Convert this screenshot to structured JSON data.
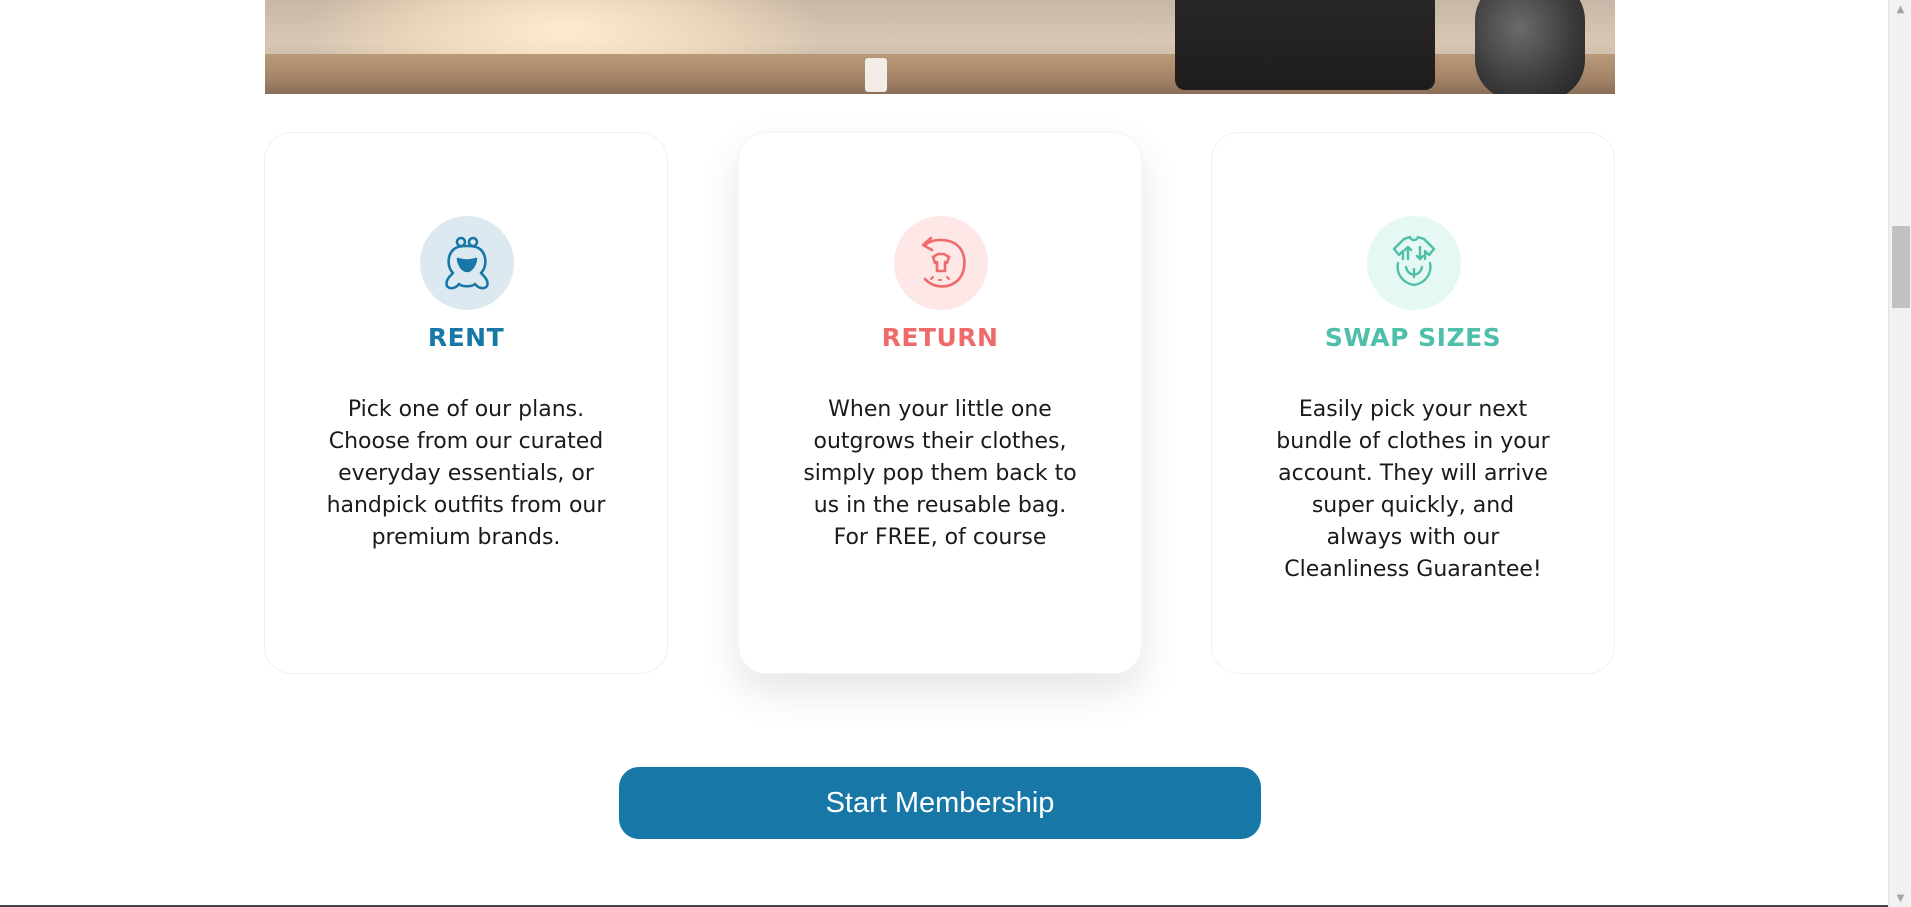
{
  "hero": {
    "alt": "hero-photo"
  },
  "cards": [
    {
      "title": "RENT",
      "text": "Pick one of our plans. Choose from our curated everyday essentials, or handpick outfits from our premium brands.",
      "icon": "frog-baby-icon",
      "title_color": "#1778a8",
      "icon_bg": "#dde9f1",
      "icon_color": "#1778a8"
    },
    {
      "title": "RETURN",
      "text": "When your little one outgrows their clothes, simply pop them back to us in the reusable bag. For FREE, of course",
      "icon": "return-shirt-icon",
      "title_color": "#ef6a6a",
      "icon_bg": "#fde7e7",
      "icon_color": "#ef6a6a"
    },
    {
      "title": "SWAP SIZES",
      "text": "Easily pick your next bundle of clothes in your account. They will arrive super quickly, and always with our Cleanliness Guarantee!",
      "icon": "swap-onesie-icon",
      "title_color": "#4fbfaa",
      "icon_bg": "#e6f8f3",
      "icon_color": "#4fbfaa"
    }
  ],
  "cta": {
    "label": "Start Membership",
    "color": "#1778a8"
  }
}
